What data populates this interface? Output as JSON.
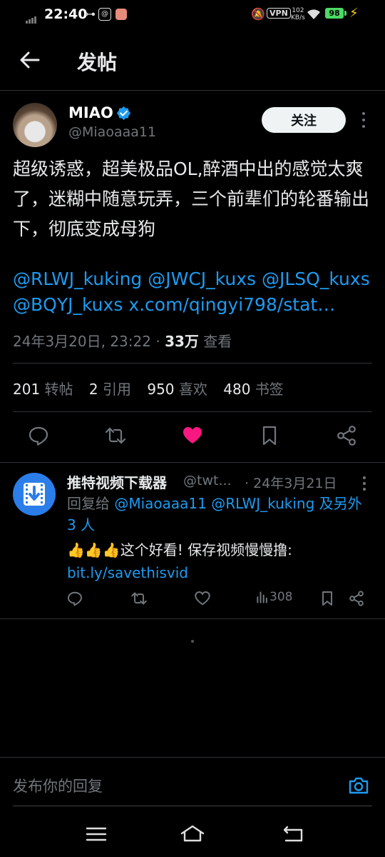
{
  "status_bar": {
    "time": "22:40",
    "vpn": "VPN",
    "speed_value": "102",
    "speed_unit": "KB/s",
    "battery": "98"
  },
  "header": {
    "title": "发帖"
  },
  "tweet": {
    "display_name": "MIAO",
    "handle": "@Miaoaaa11",
    "follow_label": "关注",
    "text": "超级诱惑，超美极品OL,醉酒中出的感觉太爽了，迷糊中随意玩弄，三个前辈们的轮番输出下，彻底变成母狗",
    "mentions": [
      "@RLWJ_kuking",
      "@JWCJ_kuxs",
      "@JLSQ_kuxs",
      "@BQYJ_kuxs"
    ],
    "link": "x.com/qingyi798/stat…",
    "date": "24年3月20日, 23:22",
    "views_count": "33万",
    "views_label": "查看",
    "separator": " · ",
    "stats": {
      "retweets_count": "201",
      "retweets_label": "转帖",
      "quotes_count": "2",
      "quotes_label": "引用",
      "likes_count": "950",
      "likes_label": "喜欢",
      "bookmarks_count": "480",
      "bookmarks_label": "书签"
    },
    "liked": true,
    "accent_color": "#1d9bf0",
    "like_color": "#f91880"
  },
  "reply": {
    "display_name": "推特视频下载器",
    "handle": "@twt...",
    "date": "· 24年3月21日",
    "reply_to_prefix": "回复给",
    "reply_to_users": "@Miaoaaa11 @RLWJ_kuking",
    "reply_to_suffix": "及另外 3 人",
    "body_text": "👍👍👍这个好看! 保存视频慢慢撸: ",
    "body_link": "bit.ly/savethisvid",
    "views": "308"
  },
  "compose": {
    "placeholder": "发布你的回复"
  }
}
